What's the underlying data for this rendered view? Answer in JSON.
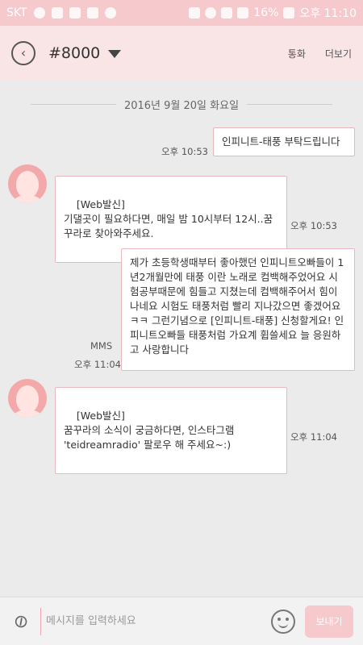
{
  "status_bar": {
    "carrier": "SKT",
    "battery_percent": "16%",
    "time": "오후 11:10",
    "left_icons": [
      "heart-icon",
      "media-icon",
      "chat-icon",
      "vibe-icon",
      "messenger-icon"
    ],
    "right_icons": [
      "mute-icon",
      "alarm-icon",
      "wifi-icon",
      "signal-icon",
      "battery-icon"
    ]
  },
  "header": {
    "title": "#8000",
    "call_label": "통화",
    "more_label": "더보기"
  },
  "date_separator": "2016년 9월 20일 화요일",
  "messages": [
    {
      "direction": "out",
      "text": "인피니트-태풍 부탁드립니다",
      "time": "오후 10:53"
    },
    {
      "direction": "in",
      "text": "[Web발신]\n기댈곳이 필요하다면, 매일 밤 10시부터 12시..꿈꾸라로 찾아와주세요.",
      "time": "오후 10:53"
    },
    {
      "direction": "out",
      "type": "MMS",
      "text": "제가 초등학생때부터 좋아했던 인피니트오빠들이 1년2개월만에 태풍 이란 노래로 컴백해주었어요 시험공부때문에 힘들고 지쳤는데 컴백해주어서 힘이나네요 시험도 태풍처럼 빨리 지나갔으면 좋겠어요ㅋㅋ 그런기념으로 [인피니트-태풍] 신청할게요! 인피니트오빠들 태풍처럼 가요계 휩쓸세요 늘 응원하고 사랑합니다",
      "time": "오후 11:04"
    },
    {
      "direction": "in",
      "text": "[Web발신]\n꿈꾸라의 소식이 궁금하다면, 인스타그램 'teidreamradio' 팔로우 해 주세요~:)",
      "time": "오후 11:04"
    }
  ],
  "compose": {
    "placeholder": "메시지를 입력하세요",
    "send_label": "보내기"
  },
  "colors": {
    "status_bar": "#f6c9cc",
    "header": "#f9e4e6",
    "background": "#ebebeb",
    "bubble_border": "#e6b8bd",
    "avatar": "#f3a9a9"
  }
}
